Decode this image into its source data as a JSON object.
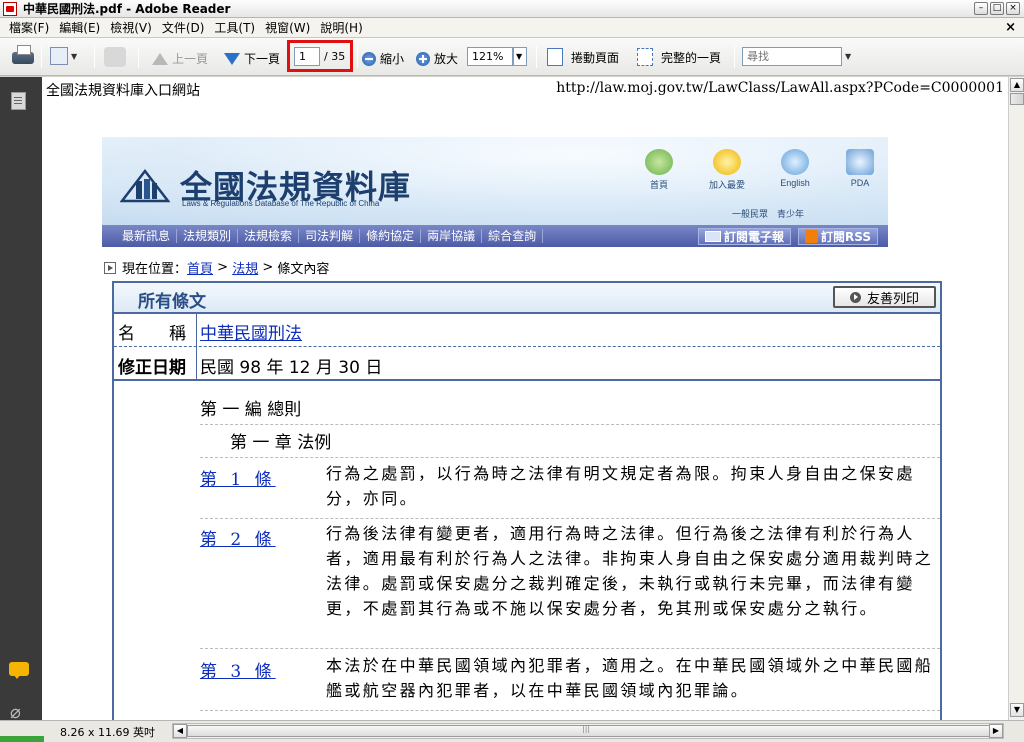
{
  "window": {
    "title": "中華民國刑法.pdf - Adobe Reader",
    "controls": [
      "–",
      "□",
      "×"
    ]
  },
  "menu": {
    "items": [
      "檔案(F)",
      "編輯(E)",
      "檢視(V)",
      "文件(D)",
      "工具(T)",
      "視窗(W)",
      "說明(H)"
    ],
    "close": "×"
  },
  "toolbar": {
    "prev_label": "上一頁",
    "next_label": "下一頁",
    "page_current": "1",
    "page_total": "/ 35",
    "zoom_out_label": "縮小",
    "zoom_in_label": "放大",
    "zoom_value": "121%",
    "scroll_mode_label": "捲動頁面",
    "fit_page_label": "完整的一頁",
    "search_placeholder": "尋找"
  },
  "document": {
    "header_left": "全國法規資料庫入口網站",
    "header_right": "http://law.moj.gov.tw/LawClass/LawAll.aspx?PCode=C0000001",
    "banner": {
      "title": "全國法規資料庫",
      "subtitle": "Laws & Regulations Database of The Republic of China",
      "icons": [
        "首頁",
        "加入最愛",
        "English",
        "PDA"
      ],
      "sub_links": "一般民眾　青少年",
      "nav": [
        "最新訊息",
        "法規類別",
        "法規檢索",
        "司法判解",
        "條約協定",
        "兩岸協議",
        "綜合查詢"
      ],
      "subscribe_email": "訂閱電子報",
      "subscribe_rss": "訂閱RSS"
    },
    "breadcrumb": {
      "prefix": "現在位置：",
      "home": "首頁",
      "sep1": " > ",
      "law": "法規",
      "sep2": " > ",
      "current": "條文內容"
    },
    "section_title": "所有條文",
    "print_button": "友善列印",
    "name_label": "名　　稱",
    "name_value": "中華民國刑法",
    "date_label": "修正日期",
    "date_value": "民國 98 年 12 月 30 日",
    "part": "第 一 編 總則",
    "chapter": "第 一 章 法例",
    "articles": [
      {
        "no": "第 1 條",
        "text": "行為之處罰，以行為時之法律有明文規定者為限。拘束人身自由之保安處分，亦同。"
      },
      {
        "no": "第 2 條",
        "text": "行為後法律有變更者，適用行為時之法律。但行為後之法律有利於行為人者，適用最有利於行為人之法律。非拘束人身自由之保安處分適用裁判時之法律。處罰或保安處分之裁判確定後，未執行或執行未完畢，而法律有變更，不處罰其行為或不施以保安處分者，免其刑或保安處分之執行。"
      },
      {
        "no": "第 3 條",
        "text": "本法於在中華民國領域內犯罪者，適用之。在中華民國領域外之中華民國船艦或航空器內犯罪者，以在中華民國領域內犯罪論。"
      }
    ]
  },
  "status": {
    "page_size": "8.26 x 11.69 英吋"
  },
  "colors": {
    "highlight": "#e01010",
    "link": "#0d2dbd",
    "border": "#4a6aa0"
  }
}
